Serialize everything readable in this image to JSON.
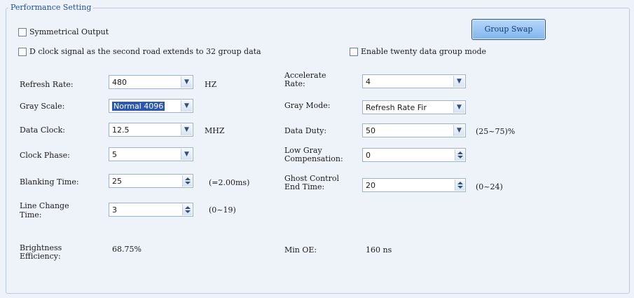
{
  "title": "Performance Setting",
  "group_swap_label": "Group Swap",
  "symmetrical_output": {
    "label": "Symmetrical Output",
    "checked": false
  },
  "d_clock": {
    "label": "D clock signal as the second road extends to 32 group data",
    "checked": false
  },
  "twenty_group": {
    "label": "Enable twenty data group mode",
    "checked": false
  },
  "left": {
    "refresh_rate": {
      "label": "Refresh Rate:",
      "value": "480",
      "unit": "HZ"
    },
    "gray_scale": {
      "label": "Gray Scale:",
      "value": "Normal 4096"
    },
    "data_clock": {
      "label": "Data Clock:",
      "value": "12.5",
      "unit": "MHZ"
    },
    "clock_phase": {
      "label": "Clock Phase:",
      "value": "5"
    },
    "blanking_time": {
      "label": "Blanking Time:",
      "value": "25",
      "hint": "(=2.00ms)"
    },
    "line_change": {
      "label_1": "Line Change",
      "label_2": "Time:",
      "value": "3",
      "hint": "(0~19)"
    }
  },
  "right": {
    "accelerate_rate": {
      "label_1": "Accelerate",
      "label_2": "Rate:",
      "value": "4"
    },
    "gray_mode": {
      "label": "Gray Mode:",
      "value": "Refresh Rate Fir"
    },
    "data_duty": {
      "label": "Data Duty:",
      "value": "50",
      "hint": "(25~75)%"
    },
    "low_gray": {
      "label_1": "Low Gray",
      "label_2": "Compensation:",
      "value": "0"
    },
    "ghost_control": {
      "label_1": "Ghost Control",
      "label_2": "End Time:",
      "value": "20",
      "hint": "(0~24)"
    }
  },
  "brightness": {
    "label_1": "Brightness",
    "label_2": "Efficiency:",
    "value": "68.75%"
  },
  "min_oe": {
    "label": "Min OE:",
    "value": "160 ns"
  },
  "icons": {
    "dropdown": "chevron-down-icon",
    "spinner": "spin-arrows-icon"
  },
  "colors": {
    "button_fill": "#8cbcf0",
    "title": "#1f4f9a",
    "panel": "#eef3fa"
  }
}
